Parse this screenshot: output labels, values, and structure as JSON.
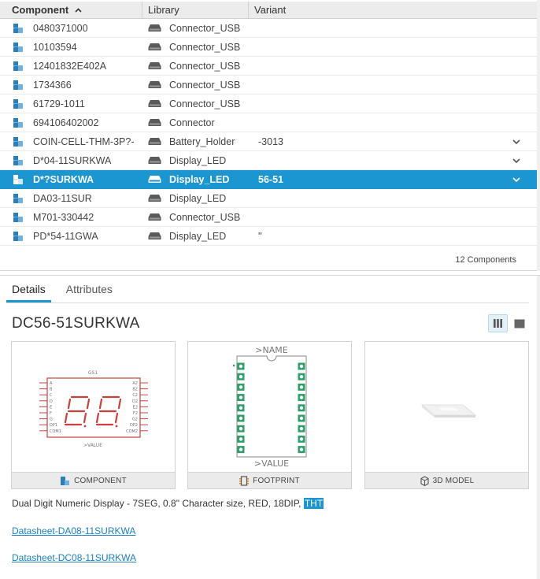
{
  "table": {
    "columns": {
      "component": "Component",
      "library": "Library",
      "variant": "Variant"
    },
    "rows": [
      {
        "component": "0480371000",
        "library": "Connector_USB",
        "variant": "",
        "chevron": false
      },
      {
        "component": "10103594",
        "library": "Connector_USB",
        "variant": "",
        "chevron": false
      },
      {
        "component": "12401832E402A",
        "library": "Connector_USB",
        "variant": "",
        "chevron": false
      },
      {
        "component": "1734366",
        "library": "Connector_USB",
        "variant": "",
        "chevron": false
      },
      {
        "component": "61729-1011",
        "library": "Connector_USB",
        "variant": "",
        "chevron": false
      },
      {
        "component": "694106402002",
        "library": "Connector",
        "variant": "",
        "chevron": false
      },
      {
        "component": "COIN-CELL-THM-3P?-",
        "library": "Battery_Holder",
        "variant": "-3013",
        "chevron": true
      },
      {
        "component": "D*04-11SURKWA",
        "library": "Display_LED",
        "variant": "",
        "chevron": true
      },
      {
        "component": "D*?SURKWA",
        "library": "Display_LED",
        "variant": "56-51",
        "chevron": true,
        "selected": true
      },
      {
        "component": "DA03-11SUR",
        "library": "Display_LED",
        "variant": "",
        "chevron": false
      },
      {
        "component": "M701-330442",
        "library": "Connector_USB",
        "variant": "",
        "chevron": false
      },
      {
        "component": "PD*54-11GWA",
        "library": "Display_LED",
        "variant": "''",
        "chevron": false
      }
    ],
    "count_label": "12 Components"
  },
  "details": {
    "tabs": [
      "Details",
      "Attributes"
    ],
    "active_tab": "Details",
    "title": "DC56-51SURKWA",
    "cards": {
      "component": {
        "label": "COMPONENT",
        "gate": "GS1",
        "value_text": ">VALUE",
        "left_pins": [
          "A",
          "B",
          "C",
          "D",
          "E",
          "F",
          "G",
          "DP1",
          "COM1"
        ],
        "right_pins": [
          "A2",
          "B2",
          "C2",
          "D2",
          "E2",
          "F2",
          "G2",
          "DP2",
          "COM2"
        ]
      },
      "footprint": {
        "label": "FOOTPRINT",
        "name_text": ">NAME",
        "value_text": ">VALUE"
      },
      "model3d": {
        "label": "3D MODEL"
      }
    },
    "description_main": "Dual Digit Numeric Display - 7SEG, 0.8\" Character size, RED, 18DIP, ",
    "description_highlight": "THT",
    "links": [
      "Datasheet-DA08-11SURKWA",
      "Datasheet-DC08-11SURKWA"
    ]
  },
  "colors": {
    "accent": "#1b96d1",
    "schematic_red": "#c8413a",
    "pad_green": "#2e9e6a",
    "link": "#1b7fc0"
  }
}
